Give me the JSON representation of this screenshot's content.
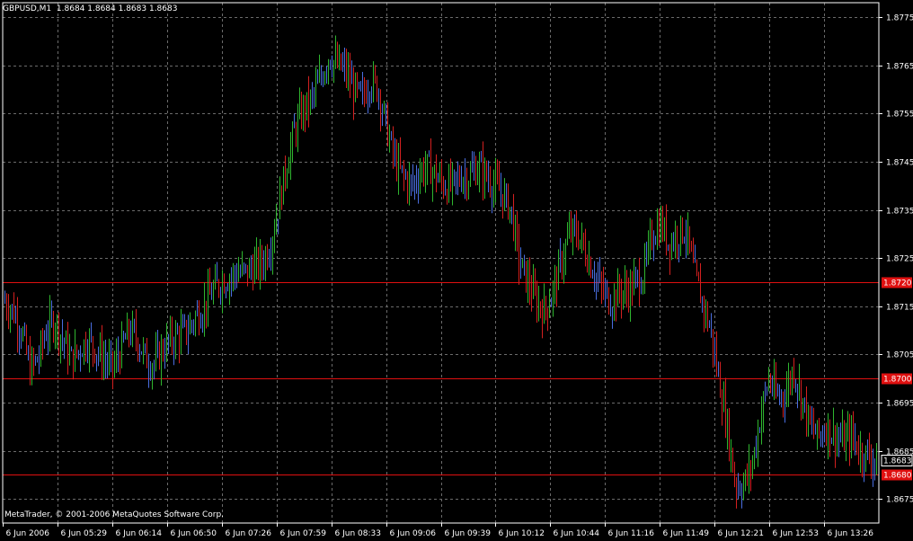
{
  "header": {
    "symbol": "GBPUSD,M1",
    "ohlc": "1.8684 1.8684 1.8683 1.8683"
  },
  "footer": {
    "copyright": "MetaTrader, © 2001-2006 MetaQuotes Software Corp."
  },
  "colors": {
    "background": "#000000",
    "grid": "#6b6b6b",
    "axis": "#ffffff",
    "bull": "#2fb62f",
    "bear": "#d42020",
    "neutral": "#4a6ee0",
    "hline": "#e01010",
    "hline_label_bg": "#e01010",
    "price_label_bg": "#000000"
  },
  "chart_data": {
    "type": "ohlc",
    "symbol": "GBPUSD",
    "timeframe": "M1",
    "ylim": [
      1.867,
      1.8778
    ],
    "y_ticks": [
      "1.8775",
      "1.8765",
      "1.8755",
      "1.8745",
      "1.8735",
      "1.8725",
      "1.8715",
      "1.8705",
      "1.8695",
      "1.8685",
      "1.8675"
    ],
    "x_ticks": [
      "6 Jun 2006",
      "6 Jun 05:29",
      "6 Jun 06:14",
      "6 Jun 06:50",
      "6 Jun 07:26",
      "6 Jun 07:59",
      "6 Jun 08:33",
      "6 Jun 09:06",
      "6 Jun 09:39",
      "6 Jun 10:12",
      "6 Jun 10:44",
      "6 Jun 11:16",
      "6 Jun 11:49",
      "6 Jun 12:21",
      "6 Jun 12:53",
      "6 Jun 13:26"
    ],
    "horizontal_lines": [
      {
        "value": 1.872,
        "label": "1.8720"
      },
      {
        "value": 1.87,
        "label": "1.8700"
      },
      {
        "value": 1.868,
        "label": "1.8680"
      }
    ],
    "current_price": {
      "value": 1.8683,
      "label": "1.8683"
    },
    "price_path": [
      [
        0,
        1.8716
      ],
      [
        1,
        1.8714
      ],
      [
        2,
        1.871
      ],
      [
        3,
        1.8702
      ],
      [
        4,
        1.8704
      ],
      [
        5,
        1.871
      ],
      [
        6,
        1.8712
      ],
      [
        7,
        1.8708
      ],
      [
        8,
        1.8704
      ],
      [
        9,
        1.8706
      ],
      [
        10,
        1.8708
      ],
      [
        11,
        1.8706
      ],
      [
        12,
        1.8704
      ],
      [
        13,
        1.8702
      ],
      [
        14,
        1.8706
      ],
      [
        15,
        1.871
      ],
      [
        16,
        1.8708
      ],
      [
        17,
        1.8704
      ],
      [
        18,
        1.8703
      ],
      [
        19,
        1.8706
      ],
      [
        20,
        1.8708
      ],
      [
        21,
        1.8709
      ],
      [
        22,
        1.871
      ],
      [
        23,
        1.8713
      ],
      [
        24,
        1.8715
      ],
      [
        25,
        1.8718
      ],
      [
        26,
        1.872
      ],
      [
        27,
        1.8721
      ],
      [
        28,
        1.8722
      ],
      [
        29,
        1.8722
      ],
      [
        30,
        1.8723
      ],
      [
        31,
        1.8724
      ],
      [
        32,
        1.8728
      ],
      [
        33,
        1.8736
      ],
      [
        34,
        1.8745
      ],
      [
        35,
        1.8752
      ],
      [
        36,
        1.8756
      ],
      [
        37,
        1.8758
      ],
      [
        38,
        1.8762
      ],
      [
        39,
        1.8767
      ],
      [
        40,
        1.8765
      ],
      [
        41,
        1.8764
      ],
      [
        42,
        1.876
      ],
      [
        43,
        1.8758
      ],
      [
        44,
        1.8762
      ],
      [
        45,
        1.876
      ],
      [
        46,
        1.8752
      ],
      [
        47,
        1.8745
      ],
      [
        48,
        1.8742
      ],
      [
        49,
        1.874
      ],
      [
        50,
        1.8743
      ],
      [
        51,
        1.8744
      ],
      [
        52,
        1.8742
      ],
      [
        53,
        1.874
      ],
      [
        54,
        1.874
      ],
      [
        55,
        1.8742
      ],
      [
        56,
        1.8742
      ],
      [
        57,
        1.8744
      ],
      [
        58,
        1.8742
      ],
      [
        59,
        1.874
      ],
      [
        60,
        1.8738
      ],
      [
        61,
        1.8735
      ],
      [
        62,
        1.8724
      ],
      [
        63,
        1.872
      ],
      [
        64,
        1.8716
      ],
      [
        65,
        1.8714
      ],
      [
        66,
        1.8718
      ],
      [
        67,
        1.8724
      ],
      [
        68,
        1.873
      ],
      [
        69,
        1.873
      ],
      [
        70,
        1.8726
      ],
      [
        71,
        1.8722
      ],
      [
        72,
        1.8718
      ],
      [
        73,
        1.8716
      ],
      [
        74,
        1.8718
      ],
      [
        75,
        1.8718
      ],
      [
        76,
        1.872
      ],
      [
        77,
        1.8722
      ],
      [
        78,
        1.873
      ],
      [
        79,
        1.8732
      ],
      [
        80,
        1.8728
      ],
      [
        81,
        1.873
      ],
      [
        82,
        1.8731
      ],
      [
        83,
        1.8722
      ],
      [
        84,
        1.8716
      ],
      [
        85,
        1.871
      ],
      [
        86,
        1.87
      ],
      [
        87,
        1.869
      ],
      [
        88,
        1.8678
      ],
      [
        89,
        1.8678
      ],
      [
        90,
        1.8682
      ],
      [
        91,
        1.8692
      ],
      [
        92,
        1.87
      ],
      [
        93,
        1.8696
      ],
      [
        94,
        1.8697
      ],
      [
        95,
        1.8702
      ],
      [
        96,
        1.8696
      ],
      [
        97,
        1.869
      ],
      [
        98,
        1.8688
      ],
      [
        99,
        1.869
      ],
      [
        100,
        1.8688
      ],
      [
        101,
        1.8687
      ],
      [
        102,
        1.8688
      ],
      [
        103,
        1.8685
      ],
      [
        104,
        1.8684
      ],
      [
        105,
        1.8683
      ]
    ]
  }
}
